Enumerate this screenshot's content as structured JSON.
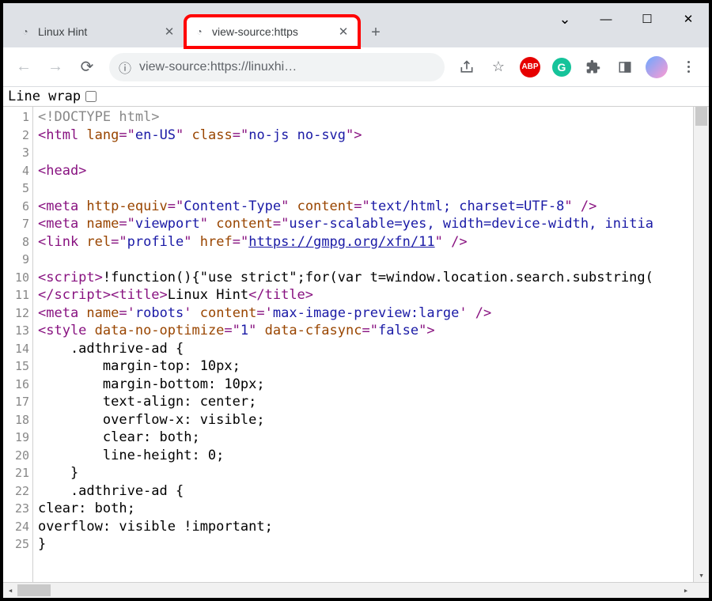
{
  "window": {
    "tabs": [
      {
        "title": "Linux Hint",
        "active": false
      },
      {
        "title": "view-source:https",
        "active": true
      }
    ],
    "controls": {
      "chevron": "⌄",
      "minimize": "—",
      "maximize": "☐",
      "close": "✕"
    }
  },
  "toolbar": {
    "url": "view-source:https://linuxhi…",
    "icons": {
      "info_tooltip": "ⓘ",
      "abp": "ABP",
      "grammarly": "G"
    }
  },
  "source": {
    "linewrap_label": "Line wrap",
    "linewrap_checked": false,
    "line_count": 25,
    "code": {
      "l1": {
        "a": "<!DOCTYPE html>"
      },
      "l2": {
        "a": "<html ",
        "b": "lang",
        "c": "=\"",
        "d": "en-US",
        "e": "\" ",
        "f": "class",
        "g": "=\"",
        "h": "no-js no-svg",
        "i": "\">"
      },
      "l4": {
        "a": "<head>"
      },
      "l6": {
        "a": "<meta ",
        "b": "http-equiv",
        "c": "=\"",
        "d": "Content-Type",
        "e": "\" ",
        "f": "content",
        "g": "=\"",
        "h": "text/html; charset=UTF-8",
        "i": "\" />"
      },
      "l7": {
        "a": "<meta ",
        "b": "name",
        "c": "=\"",
        "d": "viewport",
        "e": "\" ",
        "f": "content",
        "g": "=\"",
        "h": "user-scalable=yes, width=device-width, initia",
        "i": ""
      },
      "l8": {
        "a": "<link ",
        "b": "rel",
        "c": "=\"",
        "d": "profile",
        "e": "\" ",
        "f": "href",
        "g": "=\"",
        "h": "https://gmpg.org/xfn/11",
        "i": "\" />"
      },
      "l10": {
        "a": "<script>",
        "b": "!function(){\"use strict\";for(var t=window.location.search.substring("
      },
      "l11": {
        "a": "</script",
        "b": "><title>",
        "c": "Linux Hint",
        "d": "</title>"
      },
      "l12": {
        "a": "<meta ",
        "b": "name",
        "c": "='",
        "d": "robots",
        "e": "' ",
        "f": "content",
        "g": "='",
        "h": "max-image-preview:large",
        "i": "' />"
      },
      "l13": {
        "a": "<style ",
        "b": "data-no-optimize",
        "c": "=\"",
        "d": "1",
        "e": "\" ",
        "f": "data-cfasync",
        "g": "=\"",
        "h": "false",
        "i": "\">"
      },
      "l14": "    .adthrive-ad {",
      "l15": "        margin-top: 10px;",
      "l16": "        margin-bottom: 10px;",
      "l17": "        text-align: center;",
      "l18": "        overflow-x: visible;",
      "l19": "        clear: both;",
      "l20": "        line-height: 0;",
      "l21": "    }",
      "l22": "    .adthrive-ad {",
      "l23": "clear: both;",
      "l24": "overflow: visible !important;",
      "l25": "}"
    }
  }
}
